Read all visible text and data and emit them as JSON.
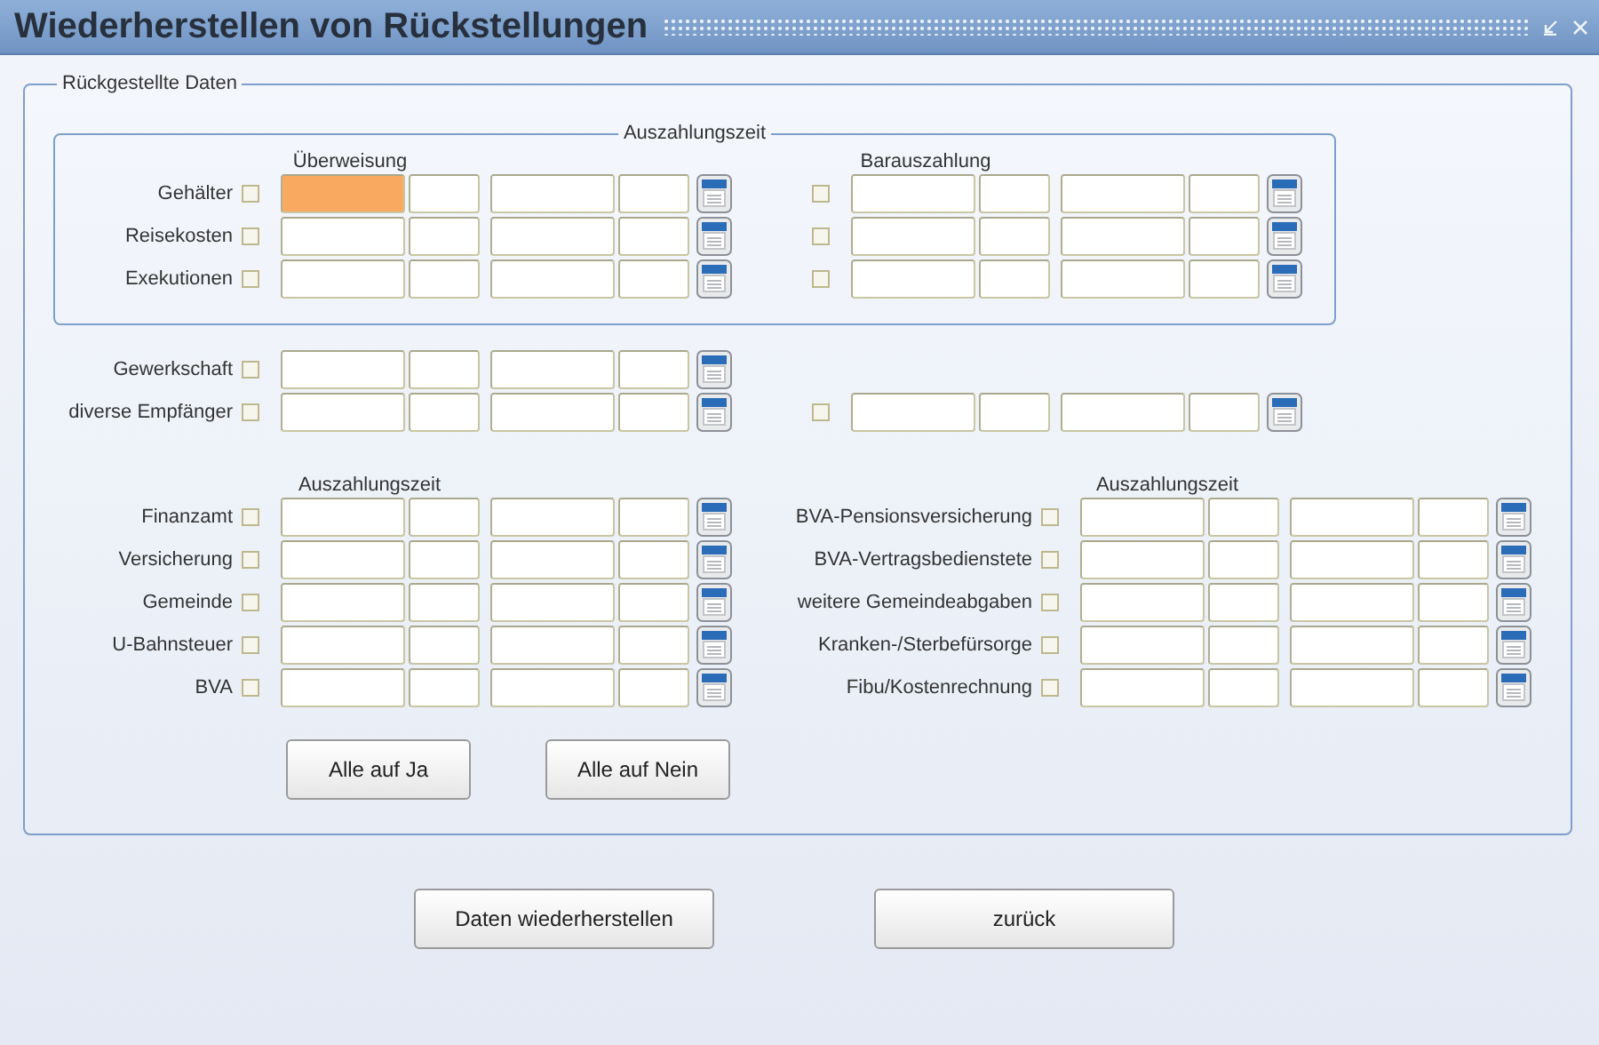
{
  "window": {
    "title": "Wiederherstellen von Rückstellungen"
  },
  "panel": {
    "title": "Rückgestellte Daten",
    "payout_group": {
      "title": "Auszahlungszeit",
      "transfer_heading": "Überweisung",
      "cash_heading": "Barauszahlung",
      "rows": [
        {
          "label": "Gehälter",
          "checked": false,
          "focused": true,
          "cash": {
            "checked": false
          }
        },
        {
          "label": "Reisekosten",
          "checked": false,
          "focused": false,
          "cash": {
            "checked": false
          }
        },
        {
          "label": "Exekutionen",
          "checked": false,
          "focused": false,
          "cash": {
            "checked": false
          }
        }
      ]
    },
    "other_rows": [
      {
        "label": "Gewerkschaft",
        "checked": false,
        "focused": false
      },
      {
        "label": "diverse Empfänger",
        "checked": false,
        "focused": false,
        "cash": {
          "checked": false
        }
      }
    ],
    "left_section": {
      "heading": "Auszahlungszeit",
      "rows": [
        {
          "label": "Finanzamt",
          "checked": false,
          "focused": false
        },
        {
          "label": "Versicherung",
          "checked": false,
          "focused": false
        },
        {
          "label": "Gemeinde",
          "checked": false,
          "focused": false
        },
        {
          "label": "U-Bahnsteuer",
          "checked": false,
          "focused": false
        },
        {
          "label": "BVA",
          "checked": false,
          "focused": false
        }
      ]
    },
    "right_section": {
      "heading": "Auszahlungszeit",
      "rows": [
        {
          "label": "BVA-Pensionsversicherung",
          "checked": false,
          "focused": false
        },
        {
          "label": "BVA-Vertragsbedienstete",
          "checked": false,
          "focused": false
        },
        {
          "label": "weitere Gemeindeabgaben",
          "checked": false,
          "focused": false
        },
        {
          "label": "Kranken-/Sterbefürsorge",
          "checked": false,
          "focused": false
        },
        {
          "label": "Fibu/Kostenrechnung",
          "checked": false,
          "focused": false
        }
      ]
    },
    "panel_buttons": [
      "Alle auf Ja",
      "Alle auf Nein"
    ]
  },
  "buttons": [
    "Daten wiederherstellen",
    "zurück"
  ]
}
